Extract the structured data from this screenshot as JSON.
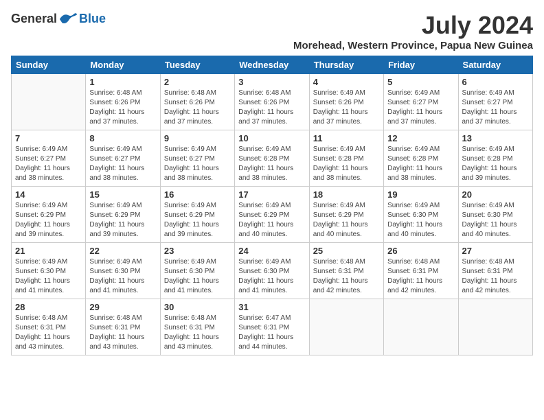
{
  "logo": {
    "general": "General",
    "blue": "Blue"
  },
  "title": "July 2024",
  "subtitle": "Morehead, Western Province, Papua New Guinea",
  "days": [
    "Sunday",
    "Monday",
    "Tuesday",
    "Wednesday",
    "Thursday",
    "Friday",
    "Saturday"
  ],
  "weeks": [
    [
      {
        "num": "",
        "sunrise": "",
        "sunset": "",
        "daylight": ""
      },
      {
        "num": "1",
        "sunrise": "Sunrise: 6:48 AM",
        "sunset": "Sunset: 6:26 PM",
        "daylight": "Daylight: 11 hours and 37 minutes."
      },
      {
        "num": "2",
        "sunrise": "Sunrise: 6:48 AM",
        "sunset": "Sunset: 6:26 PM",
        "daylight": "Daylight: 11 hours and 37 minutes."
      },
      {
        "num": "3",
        "sunrise": "Sunrise: 6:48 AM",
        "sunset": "Sunset: 6:26 PM",
        "daylight": "Daylight: 11 hours and 37 minutes."
      },
      {
        "num": "4",
        "sunrise": "Sunrise: 6:49 AM",
        "sunset": "Sunset: 6:26 PM",
        "daylight": "Daylight: 11 hours and 37 minutes."
      },
      {
        "num": "5",
        "sunrise": "Sunrise: 6:49 AM",
        "sunset": "Sunset: 6:27 PM",
        "daylight": "Daylight: 11 hours and 37 minutes."
      },
      {
        "num": "6",
        "sunrise": "Sunrise: 6:49 AM",
        "sunset": "Sunset: 6:27 PM",
        "daylight": "Daylight: 11 hours and 37 minutes."
      }
    ],
    [
      {
        "num": "7",
        "sunrise": "Sunrise: 6:49 AM",
        "sunset": "Sunset: 6:27 PM",
        "daylight": "Daylight: 11 hours and 38 minutes."
      },
      {
        "num": "8",
        "sunrise": "Sunrise: 6:49 AM",
        "sunset": "Sunset: 6:27 PM",
        "daylight": "Daylight: 11 hours and 38 minutes."
      },
      {
        "num": "9",
        "sunrise": "Sunrise: 6:49 AM",
        "sunset": "Sunset: 6:27 PM",
        "daylight": "Daylight: 11 hours and 38 minutes."
      },
      {
        "num": "10",
        "sunrise": "Sunrise: 6:49 AM",
        "sunset": "Sunset: 6:28 PM",
        "daylight": "Daylight: 11 hours and 38 minutes."
      },
      {
        "num": "11",
        "sunrise": "Sunrise: 6:49 AM",
        "sunset": "Sunset: 6:28 PM",
        "daylight": "Daylight: 11 hours and 38 minutes."
      },
      {
        "num": "12",
        "sunrise": "Sunrise: 6:49 AM",
        "sunset": "Sunset: 6:28 PM",
        "daylight": "Daylight: 11 hours and 38 minutes."
      },
      {
        "num": "13",
        "sunrise": "Sunrise: 6:49 AM",
        "sunset": "Sunset: 6:28 PM",
        "daylight": "Daylight: 11 hours and 39 minutes."
      }
    ],
    [
      {
        "num": "14",
        "sunrise": "Sunrise: 6:49 AM",
        "sunset": "Sunset: 6:29 PM",
        "daylight": "Daylight: 11 hours and 39 minutes."
      },
      {
        "num": "15",
        "sunrise": "Sunrise: 6:49 AM",
        "sunset": "Sunset: 6:29 PM",
        "daylight": "Daylight: 11 hours and 39 minutes."
      },
      {
        "num": "16",
        "sunrise": "Sunrise: 6:49 AM",
        "sunset": "Sunset: 6:29 PM",
        "daylight": "Daylight: 11 hours and 39 minutes."
      },
      {
        "num": "17",
        "sunrise": "Sunrise: 6:49 AM",
        "sunset": "Sunset: 6:29 PM",
        "daylight": "Daylight: 11 hours and 40 minutes."
      },
      {
        "num": "18",
        "sunrise": "Sunrise: 6:49 AM",
        "sunset": "Sunset: 6:29 PM",
        "daylight": "Daylight: 11 hours and 40 minutes."
      },
      {
        "num": "19",
        "sunrise": "Sunrise: 6:49 AM",
        "sunset": "Sunset: 6:30 PM",
        "daylight": "Daylight: 11 hours and 40 minutes."
      },
      {
        "num": "20",
        "sunrise": "Sunrise: 6:49 AM",
        "sunset": "Sunset: 6:30 PM",
        "daylight": "Daylight: 11 hours and 40 minutes."
      }
    ],
    [
      {
        "num": "21",
        "sunrise": "Sunrise: 6:49 AM",
        "sunset": "Sunset: 6:30 PM",
        "daylight": "Daylight: 11 hours and 41 minutes."
      },
      {
        "num": "22",
        "sunrise": "Sunrise: 6:49 AM",
        "sunset": "Sunset: 6:30 PM",
        "daylight": "Daylight: 11 hours and 41 minutes."
      },
      {
        "num": "23",
        "sunrise": "Sunrise: 6:49 AM",
        "sunset": "Sunset: 6:30 PM",
        "daylight": "Daylight: 11 hours and 41 minutes."
      },
      {
        "num": "24",
        "sunrise": "Sunrise: 6:49 AM",
        "sunset": "Sunset: 6:30 PM",
        "daylight": "Daylight: 11 hours and 41 minutes."
      },
      {
        "num": "25",
        "sunrise": "Sunrise: 6:48 AM",
        "sunset": "Sunset: 6:31 PM",
        "daylight": "Daylight: 11 hours and 42 minutes."
      },
      {
        "num": "26",
        "sunrise": "Sunrise: 6:48 AM",
        "sunset": "Sunset: 6:31 PM",
        "daylight": "Daylight: 11 hours and 42 minutes."
      },
      {
        "num": "27",
        "sunrise": "Sunrise: 6:48 AM",
        "sunset": "Sunset: 6:31 PM",
        "daylight": "Daylight: 11 hours and 42 minutes."
      }
    ],
    [
      {
        "num": "28",
        "sunrise": "Sunrise: 6:48 AM",
        "sunset": "Sunset: 6:31 PM",
        "daylight": "Daylight: 11 hours and 43 minutes."
      },
      {
        "num": "29",
        "sunrise": "Sunrise: 6:48 AM",
        "sunset": "Sunset: 6:31 PM",
        "daylight": "Daylight: 11 hours and 43 minutes."
      },
      {
        "num": "30",
        "sunrise": "Sunrise: 6:48 AM",
        "sunset": "Sunset: 6:31 PM",
        "daylight": "Daylight: 11 hours and 43 minutes."
      },
      {
        "num": "31",
        "sunrise": "Sunrise: 6:47 AM",
        "sunset": "Sunset: 6:31 PM",
        "daylight": "Daylight: 11 hours and 44 minutes."
      },
      {
        "num": "",
        "sunrise": "",
        "sunset": "",
        "daylight": ""
      },
      {
        "num": "",
        "sunrise": "",
        "sunset": "",
        "daylight": ""
      },
      {
        "num": "",
        "sunrise": "",
        "sunset": "",
        "daylight": ""
      }
    ]
  ]
}
